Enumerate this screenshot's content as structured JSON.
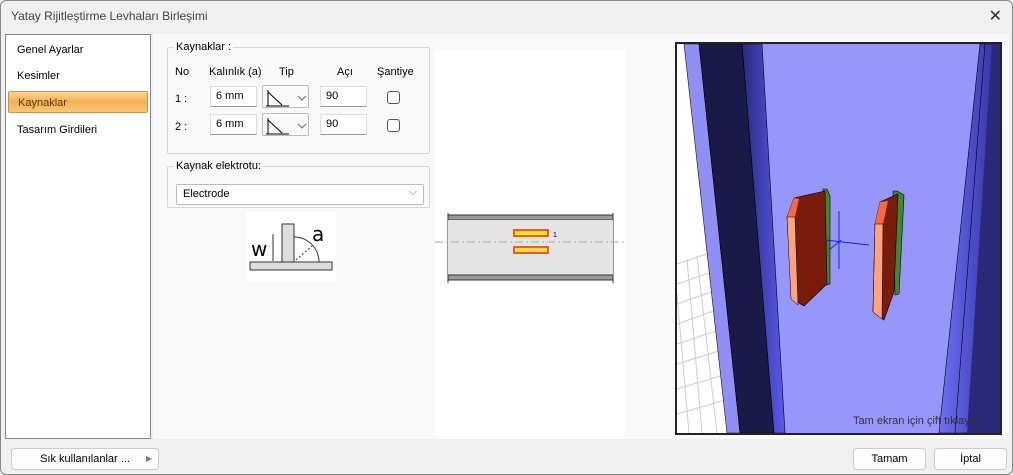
{
  "window": {
    "title": "Yatay Rijitleştirme Levhaları Birleşimi",
    "close": "✕"
  },
  "nav": {
    "items": [
      {
        "label": "Genel Ayarlar"
      },
      {
        "label": "Kesimler"
      },
      {
        "label": "Kaynaklar",
        "active": true
      },
      {
        "label": "Tasarım Girdileri"
      }
    ]
  },
  "welds": {
    "legend": "Kaynaklar :",
    "headers": {
      "no": "No",
      "thickness": "Kalınlık (a)",
      "type": "Tip",
      "angle": "Açı",
      "site": "Şantiye"
    },
    "rows": [
      {
        "no": "1 :",
        "thickness": "6 mm",
        "angle": "90",
        "site": false
      },
      {
        "no": "2 :",
        "thickness": "6 mm",
        "angle": "90",
        "site": false
      }
    ]
  },
  "electrode": {
    "legend": "Kaynak elektrotu:",
    "value": "Electrode"
  },
  "diagram": {
    "w": "w",
    "a": "a",
    "weld_number": "1"
  },
  "view3d": {
    "hint": "Tam ekran için çift tıklayın."
  },
  "footer": {
    "favorites": "Sık kullanılanlar ...",
    "ok": "Tamam",
    "cancel": "İptal"
  }
}
